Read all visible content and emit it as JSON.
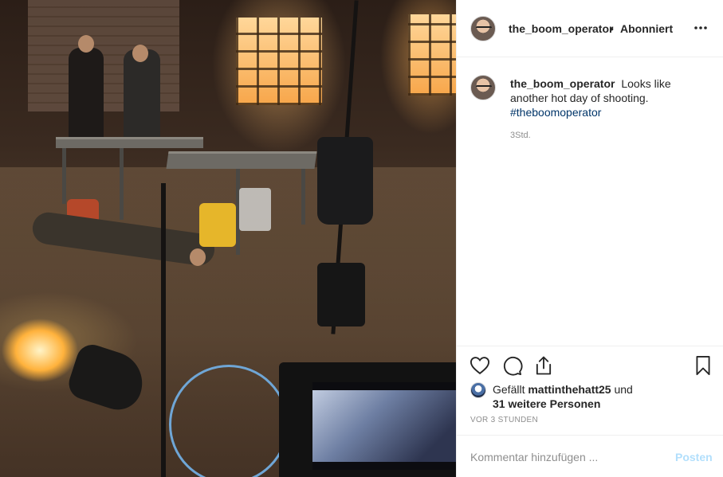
{
  "post": {
    "image_alt": "the_boom_operator film set photo",
    "header": {
      "username": "the_boom_operator",
      "separator": "•",
      "follow_status": "Abonniert",
      "more_icon": "more-horizontal-icon"
    },
    "caption": {
      "username": "the_boom_operator",
      "text": "Looks like another hot day of shooting.",
      "hashtag": "#theboomoperator",
      "time": "3Std."
    },
    "actions": {
      "like_icon": "heart-icon",
      "comment_icon": "comment-icon",
      "share_icon": "share-icon",
      "save_icon": "bookmark-icon"
    },
    "likes": {
      "prefix": "Gefällt ",
      "user": "mattinthehatt25",
      "middle": " und ",
      "others": "31 weitere Personen"
    },
    "posted_ago": "VOR 3 STUNDEN",
    "comment_box": {
      "placeholder": "Kommentar hinzufügen ...",
      "post_label": "Posten"
    }
  }
}
